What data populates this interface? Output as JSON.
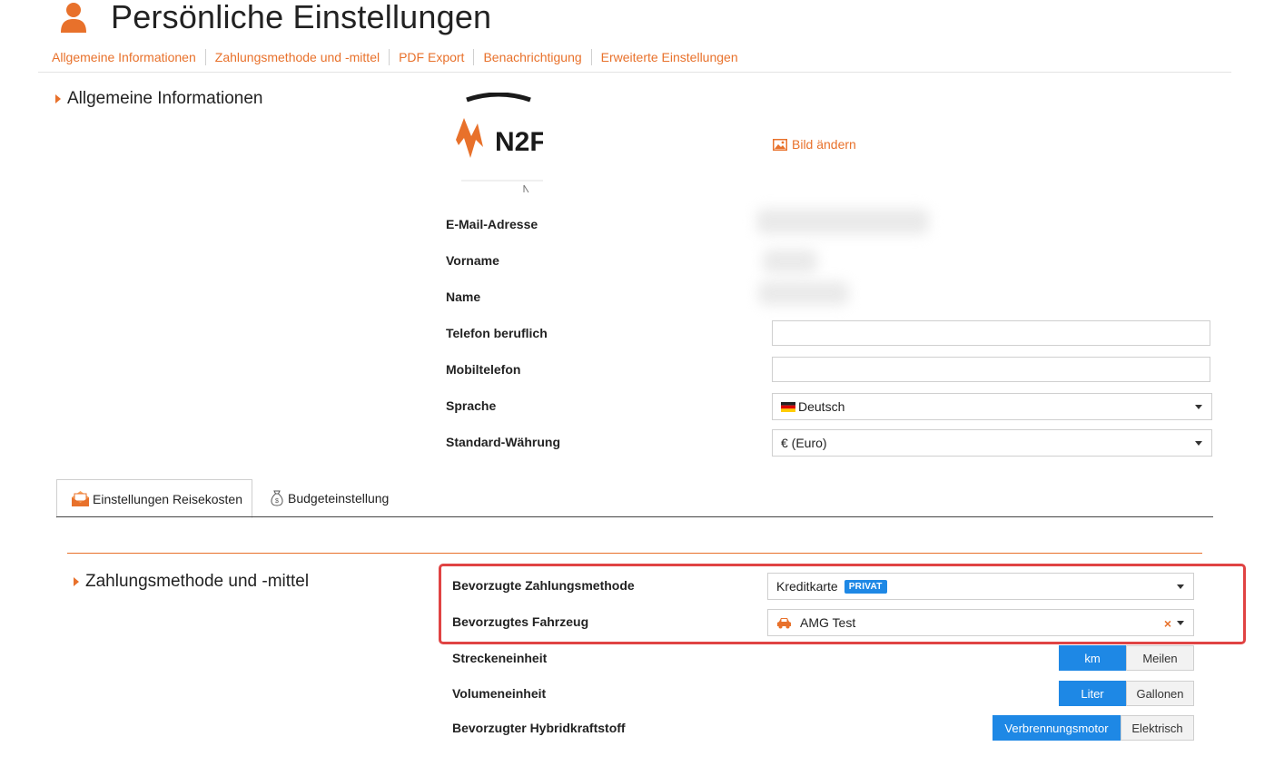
{
  "header": {
    "title": "Persönliche Einstellungen"
  },
  "subnav": [
    {
      "label": "Allgemeine Informationen"
    },
    {
      "label": "Zahlungsmethode und -mittel"
    },
    {
      "label": "PDF Export"
    },
    {
      "label": "Benachrichtigung"
    },
    {
      "label": "Erweiterte Einstellungen"
    }
  ],
  "general": {
    "heading": "Allgemeine Informationen",
    "logo_text": "N2F",
    "change_image": "Bild ändern",
    "email_label": "E-Mail-Adresse",
    "firstname_label": "Vorname",
    "name_label": "Name",
    "phone_work_label": "Telefon beruflich",
    "phone_work_value": "",
    "mobile_label": "Mobiltelefon",
    "mobile_value": "",
    "language_label": "Sprache",
    "language_value": "Deutsch",
    "currency_label": "Standard-Währung",
    "currency_value": "€ (Euro)"
  },
  "tabs": [
    {
      "label": "Einstellungen Reisekosten",
      "active": true
    },
    {
      "label": "Budgeteinstellung",
      "active": false
    }
  ],
  "payment": {
    "heading": "Zahlungsmethode und -mittel",
    "method_label": "Bevorzugte Zahlungsmethode",
    "method_value": "Kreditkarte",
    "method_badge": "PRIVAT",
    "vehicle_label": "Bevorzugtes Fahrzeug",
    "vehicle_value": "AMG Test",
    "distance_label": "Streckeneinheit",
    "distance_options": [
      "km",
      "Meilen"
    ],
    "distance_selected": "km",
    "volume_label": "Volumeneinheit",
    "volume_options": [
      "Liter",
      "Gallonen"
    ],
    "volume_selected": "Liter",
    "hybrid_label": "Bevorzugter Hybridkraftstoff",
    "hybrid_options": [
      "Verbrennungsmotor",
      "Elektrisch"
    ],
    "hybrid_selected": "Verbrennungsmotor"
  },
  "colors": {
    "accent": "#e8712b",
    "primary": "#1e88e5",
    "highlight": "#e04343"
  }
}
